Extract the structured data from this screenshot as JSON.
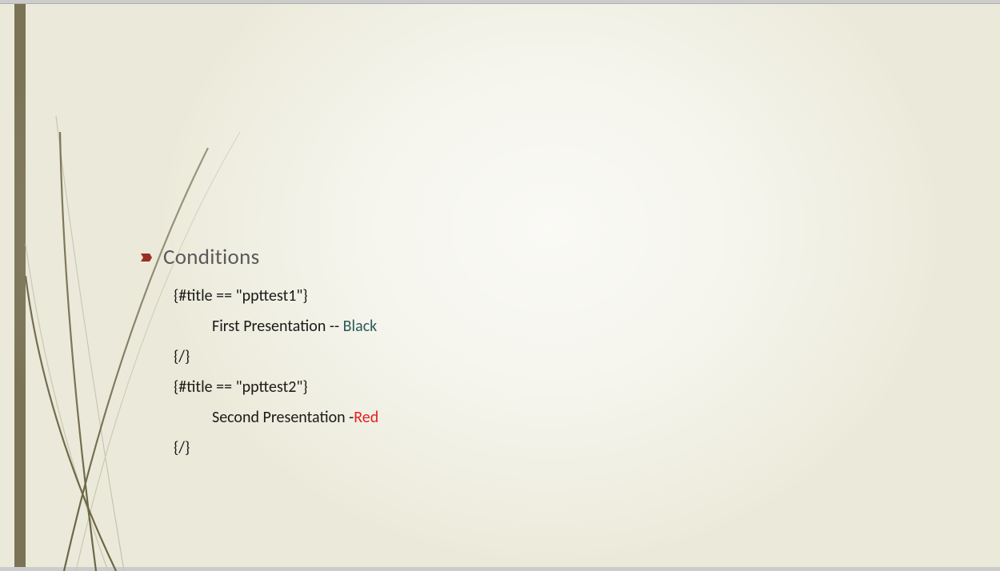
{
  "slide": {
    "title": "Conditions",
    "lines": {
      "cond1_open": "{#title == \"ppttest1\"}",
      "line1_prefix": "First Presentation  -- ",
      "line1_color_word": "Black",
      "close1": "{/}",
      "cond2_open": "{#title == \"ppttest2\"}",
      "line2_prefix": "Second Presentation -",
      "line2_color_word": "Red",
      "close2": "{/}"
    }
  }
}
